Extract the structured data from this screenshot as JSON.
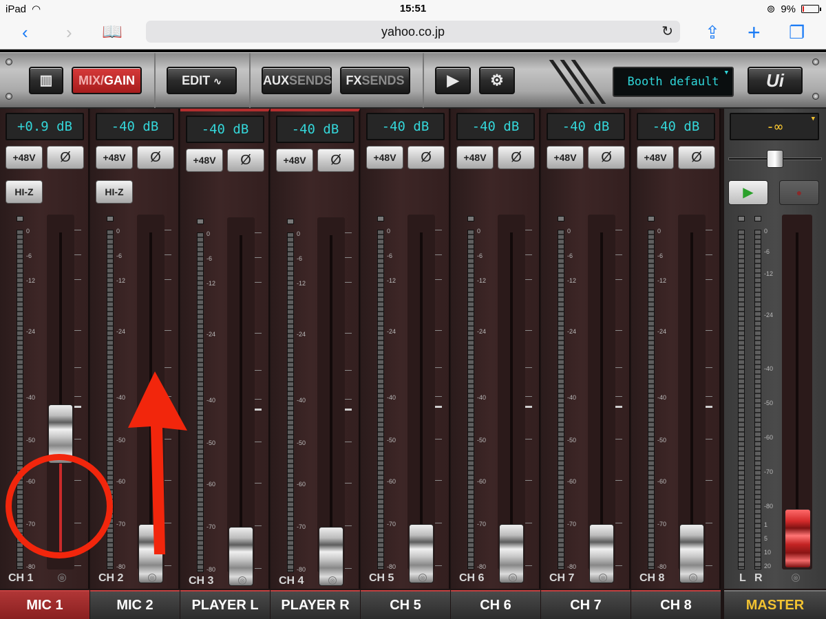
{
  "status_bar": {
    "device": "iPad",
    "time": "15:51",
    "battery": "9%",
    "battery_level": 0.09
  },
  "browser": {
    "url": "yahoo.co.jp"
  },
  "header": {
    "view_button": "",
    "mix_label": "MIX/",
    "gain_label": "GAIN",
    "edit_label": "EDIT",
    "aux_label_a": "AUX",
    "aux_label_b": "SENDS",
    "fx_label_a": "FX",
    "fx_label_b": "SENDS",
    "snapshot": "Booth default",
    "logo": "Ui"
  },
  "channels": [
    {
      "gain": "+0.9 dB",
      "hiz": "HI-Z",
      "ch": "CH 1",
      "name": "MIC 1",
      "fader_level_db": -40
    },
    {
      "gain": "-40 dB",
      "hiz": "HI-Z",
      "ch": "CH 2",
      "name": "MIC 2",
      "fader_level_db": -70
    },
    {
      "gain": "-40 dB",
      "ch": "CH 3",
      "name": "PLAYER L",
      "fader_level_db": -70
    },
    {
      "gain": "-40 dB",
      "ch": "CH 4",
      "name": "PLAYER R",
      "fader_level_db": -70
    },
    {
      "gain": "-40 dB",
      "ch": "CH 5",
      "name": "CH 5",
      "fader_level_db": -70
    },
    {
      "gain": "-40 dB",
      "ch": "CH 6",
      "name": "CH 6",
      "fader_level_db": -70
    },
    {
      "gain": "-40 dB",
      "ch": "CH 7",
      "name": "CH 7",
      "fader_level_db": -70
    },
    {
      "gain": "-40 dB",
      "ch": "CH 8",
      "name": "CH 8",
      "fader_level_db": -70
    }
  ],
  "buttons": {
    "phantom": "+48V",
    "phase": "Ø"
  },
  "scale": [
    "0",
    "-6",
    "-12",
    "-24",
    "-40",
    "-50",
    "-60",
    "-70",
    "-80"
  ],
  "master": {
    "gain": "-∞",
    "name": "MASTER",
    "left": "L",
    "right": "R",
    "scale": [
      "0",
      "-6",
      "-12",
      "-24",
      "-40",
      "-50",
      "-60",
      "-70",
      "-80"
    ],
    "scale_low": [
      "1",
      "5",
      "10",
      "20"
    ]
  },
  "colors": {
    "accent_red": "#b32e2e",
    "lcd_cyan": "#34d6d9",
    "master_yellow": "#f2c231",
    "annotation": "#f2260c"
  }
}
